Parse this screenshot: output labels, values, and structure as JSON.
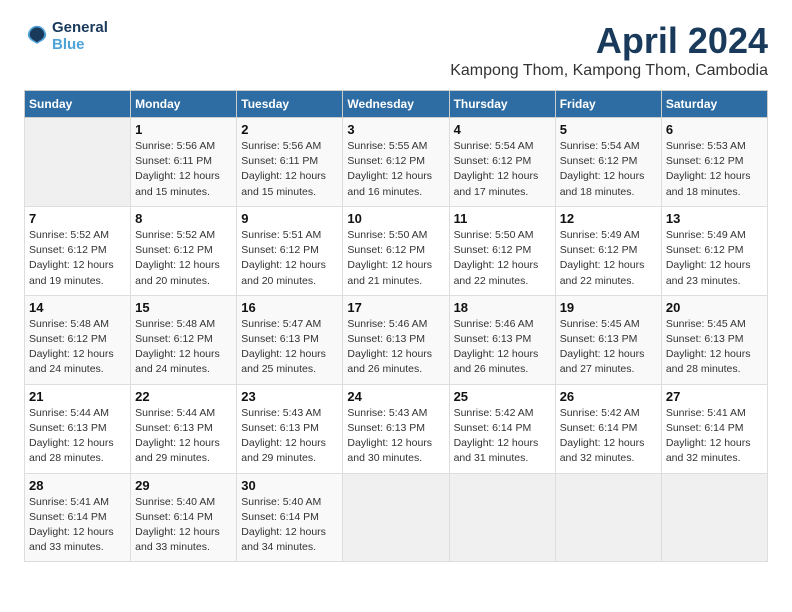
{
  "header": {
    "logo_line1": "General",
    "logo_line2": "Blue",
    "title": "April 2024",
    "subtitle": "Kampong Thom, Kampong Thom, Cambodia"
  },
  "calendar": {
    "days_of_week": [
      "Sunday",
      "Monday",
      "Tuesday",
      "Wednesday",
      "Thursday",
      "Friday",
      "Saturday"
    ],
    "weeks": [
      [
        {
          "day": "",
          "info": ""
        },
        {
          "day": "1",
          "info": "Sunrise: 5:56 AM\nSunset: 6:11 PM\nDaylight: 12 hours\nand 15 minutes."
        },
        {
          "day": "2",
          "info": "Sunrise: 5:56 AM\nSunset: 6:11 PM\nDaylight: 12 hours\nand 15 minutes."
        },
        {
          "day": "3",
          "info": "Sunrise: 5:55 AM\nSunset: 6:12 PM\nDaylight: 12 hours\nand 16 minutes."
        },
        {
          "day": "4",
          "info": "Sunrise: 5:54 AM\nSunset: 6:12 PM\nDaylight: 12 hours\nand 17 minutes."
        },
        {
          "day": "5",
          "info": "Sunrise: 5:54 AM\nSunset: 6:12 PM\nDaylight: 12 hours\nand 18 minutes."
        },
        {
          "day": "6",
          "info": "Sunrise: 5:53 AM\nSunset: 6:12 PM\nDaylight: 12 hours\nand 18 minutes."
        }
      ],
      [
        {
          "day": "7",
          "info": "Sunrise: 5:52 AM\nSunset: 6:12 PM\nDaylight: 12 hours\nand 19 minutes."
        },
        {
          "day": "8",
          "info": "Sunrise: 5:52 AM\nSunset: 6:12 PM\nDaylight: 12 hours\nand 20 minutes."
        },
        {
          "day": "9",
          "info": "Sunrise: 5:51 AM\nSunset: 6:12 PM\nDaylight: 12 hours\nand 20 minutes."
        },
        {
          "day": "10",
          "info": "Sunrise: 5:50 AM\nSunset: 6:12 PM\nDaylight: 12 hours\nand 21 minutes."
        },
        {
          "day": "11",
          "info": "Sunrise: 5:50 AM\nSunset: 6:12 PM\nDaylight: 12 hours\nand 22 minutes."
        },
        {
          "day": "12",
          "info": "Sunrise: 5:49 AM\nSunset: 6:12 PM\nDaylight: 12 hours\nand 22 minutes."
        },
        {
          "day": "13",
          "info": "Sunrise: 5:49 AM\nSunset: 6:12 PM\nDaylight: 12 hours\nand 23 minutes."
        }
      ],
      [
        {
          "day": "14",
          "info": "Sunrise: 5:48 AM\nSunset: 6:12 PM\nDaylight: 12 hours\nand 24 minutes."
        },
        {
          "day": "15",
          "info": "Sunrise: 5:48 AM\nSunset: 6:12 PM\nDaylight: 12 hours\nand 24 minutes."
        },
        {
          "day": "16",
          "info": "Sunrise: 5:47 AM\nSunset: 6:13 PM\nDaylight: 12 hours\nand 25 minutes."
        },
        {
          "day": "17",
          "info": "Sunrise: 5:46 AM\nSunset: 6:13 PM\nDaylight: 12 hours\nand 26 minutes."
        },
        {
          "day": "18",
          "info": "Sunrise: 5:46 AM\nSunset: 6:13 PM\nDaylight: 12 hours\nand 26 minutes."
        },
        {
          "day": "19",
          "info": "Sunrise: 5:45 AM\nSunset: 6:13 PM\nDaylight: 12 hours\nand 27 minutes."
        },
        {
          "day": "20",
          "info": "Sunrise: 5:45 AM\nSunset: 6:13 PM\nDaylight: 12 hours\nand 28 minutes."
        }
      ],
      [
        {
          "day": "21",
          "info": "Sunrise: 5:44 AM\nSunset: 6:13 PM\nDaylight: 12 hours\nand 28 minutes."
        },
        {
          "day": "22",
          "info": "Sunrise: 5:44 AM\nSunset: 6:13 PM\nDaylight: 12 hours\nand 29 minutes."
        },
        {
          "day": "23",
          "info": "Sunrise: 5:43 AM\nSunset: 6:13 PM\nDaylight: 12 hours\nand 29 minutes."
        },
        {
          "day": "24",
          "info": "Sunrise: 5:43 AM\nSunset: 6:13 PM\nDaylight: 12 hours\nand 30 minutes."
        },
        {
          "day": "25",
          "info": "Sunrise: 5:42 AM\nSunset: 6:14 PM\nDaylight: 12 hours\nand 31 minutes."
        },
        {
          "day": "26",
          "info": "Sunrise: 5:42 AM\nSunset: 6:14 PM\nDaylight: 12 hours\nand 32 minutes."
        },
        {
          "day": "27",
          "info": "Sunrise: 5:41 AM\nSunset: 6:14 PM\nDaylight: 12 hours\nand 32 minutes."
        }
      ],
      [
        {
          "day": "28",
          "info": "Sunrise: 5:41 AM\nSunset: 6:14 PM\nDaylight: 12 hours\nand 33 minutes."
        },
        {
          "day": "29",
          "info": "Sunrise: 5:40 AM\nSunset: 6:14 PM\nDaylight: 12 hours\nand 33 minutes."
        },
        {
          "day": "30",
          "info": "Sunrise: 5:40 AM\nSunset: 6:14 PM\nDaylight: 12 hours\nand 34 minutes."
        },
        {
          "day": "",
          "info": ""
        },
        {
          "day": "",
          "info": ""
        },
        {
          "day": "",
          "info": ""
        },
        {
          "day": "",
          "info": ""
        }
      ]
    ]
  }
}
